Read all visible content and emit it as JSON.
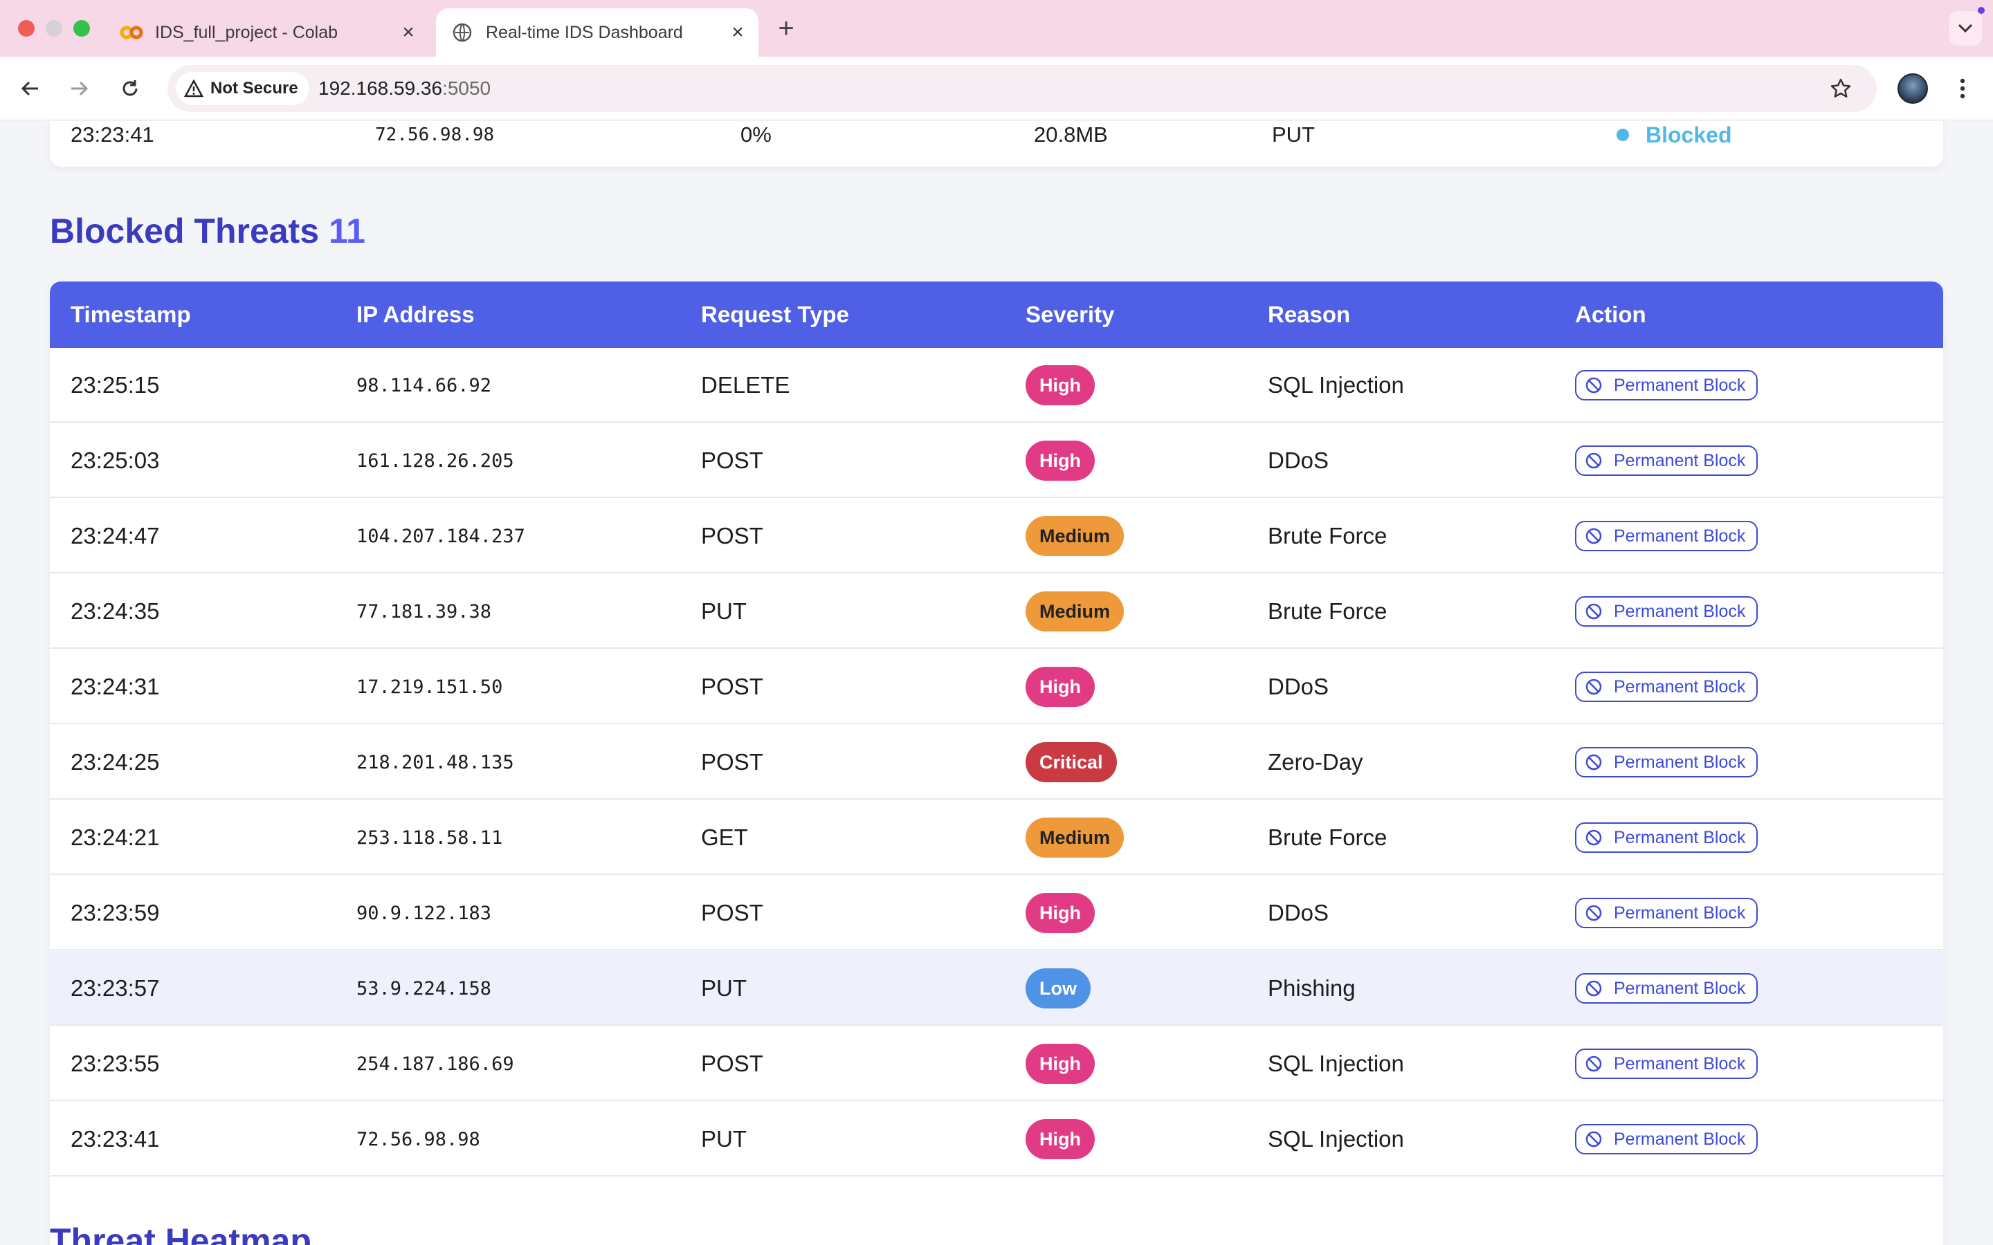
{
  "browser": {
    "tabs": [
      {
        "title": "IDS_full_project - Colab",
        "icon": "colab-icon"
      },
      {
        "title": "Real-time IDS Dashboard",
        "icon": "globe-icon",
        "active": true
      }
    ],
    "security_label": "Not Secure",
    "url_host": "192.168.59.36",
    "url_port": ":5050"
  },
  "prev_row": {
    "timestamp": "23:23:41",
    "ip": "72.56.98.98",
    "percent": "0%",
    "size": "20.8MB",
    "method": "PUT",
    "status": "Blocked",
    "status_color": "#4fb8e8"
  },
  "blocked": {
    "title": "Blocked Threats",
    "count": "11",
    "columns": {
      "timestamp": "Timestamp",
      "ip": "IP Address",
      "request": "Request Type",
      "severity": "Severity",
      "reason": "Reason",
      "action": "Action"
    },
    "rows": [
      {
        "timestamp": "23:25:15",
        "ip": "98.114.66.92",
        "request": "DELETE",
        "severity": "High",
        "reason": "SQL Injection",
        "action": "Permanent Block"
      },
      {
        "timestamp": "23:25:03",
        "ip": "161.128.26.205",
        "request": "POST",
        "severity": "High",
        "reason": "DDoS",
        "action": "Permanent Block"
      },
      {
        "timestamp": "23:24:47",
        "ip": "104.207.184.237",
        "request": "POST",
        "severity": "Medium",
        "reason": "Brute Force",
        "action": "Permanent Block"
      },
      {
        "timestamp": "23:24:35",
        "ip": "77.181.39.38",
        "request": "PUT",
        "severity": "Medium",
        "reason": "Brute Force",
        "action": "Permanent Block"
      },
      {
        "timestamp": "23:24:31",
        "ip": "17.219.151.50",
        "request": "POST",
        "severity": "High",
        "reason": "DDoS",
        "action": "Permanent Block"
      },
      {
        "timestamp": "23:24:25",
        "ip": "218.201.48.135",
        "request": "POST",
        "severity": "Critical",
        "reason": "Zero-Day",
        "action": "Permanent Block"
      },
      {
        "timestamp": "23:24:21",
        "ip": "253.118.58.11",
        "request": "GET",
        "severity": "Medium",
        "reason": "Brute Force",
        "action": "Permanent Block"
      },
      {
        "timestamp": "23:23:59",
        "ip": "90.9.122.183",
        "request": "POST",
        "severity": "High",
        "reason": "DDoS",
        "action": "Permanent Block"
      },
      {
        "timestamp": "23:23:57",
        "ip": "53.9.224.158",
        "request": "PUT",
        "severity": "Low",
        "reason": "Phishing",
        "action": "Permanent Block",
        "highlighted": true
      },
      {
        "timestamp": "23:23:55",
        "ip": "254.187.186.69",
        "request": "POST",
        "severity": "High",
        "reason": "SQL Injection",
        "action": "Permanent Block"
      },
      {
        "timestamp": "23:23:41",
        "ip": "72.56.98.98",
        "request": "PUT",
        "severity": "High",
        "reason": "SQL Injection",
        "action": "Permanent Block"
      }
    ]
  },
  "severity_colors": {
    "High": "#e23b86",
    "Medium": "#ef9a3a",
    "Critical": "#c93a42",
    "Low": "#4f93e6"
  },
  "heatmap": {
    "title": "Threat Heatmap"
  }
}
